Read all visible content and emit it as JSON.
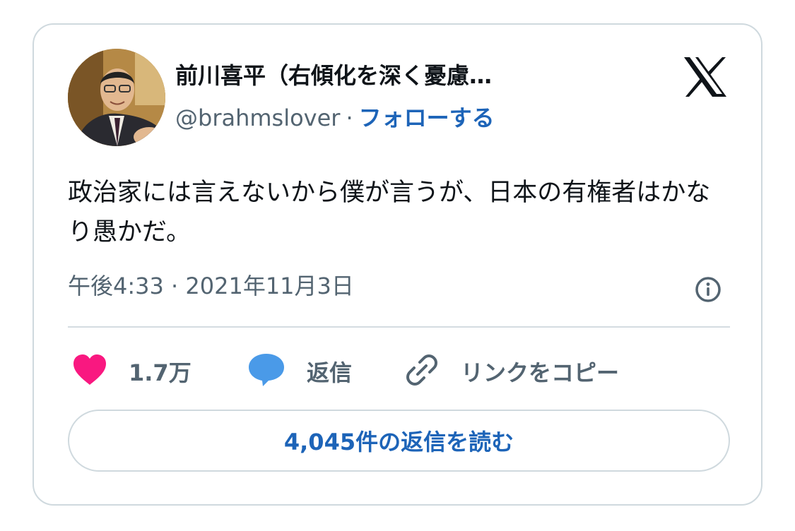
{
  "author": {
    "name": "前川喜平（右傾化を深く憂慮する一…",
    "handle": "@brahmslover",
    "separator": "·",
    "follow_label": "フォローする"
  },
  "tweet": {
    "text": "政治家には言えないから僕が言うが、日本の有権者はかなり愚かだ。",
    "timestamp": "午後4:33 · 2021年11月3日"
  },
  "actions": {
    "likes": "1.7万",
    "reply_label": "返信",
    "copy_link_label": "リンクをコピー"
  },
  "read_replies_label": "4,045件の返信を読む",
  "icons": {
    "brand": "x-logo-icon",
    "info": "info-icon",
    "like": "heart-icon",
    "reply": "speech-bubble-icon",
    "link": "link-icon"
  },
  "colors": {
    "follow": "#1d64b8",
    "heart": "#f91880",
    "reply_bubble": "#4a9ae8",
    "muted_text": "#536471",
    "border": "#cfd9de"
  }
}
